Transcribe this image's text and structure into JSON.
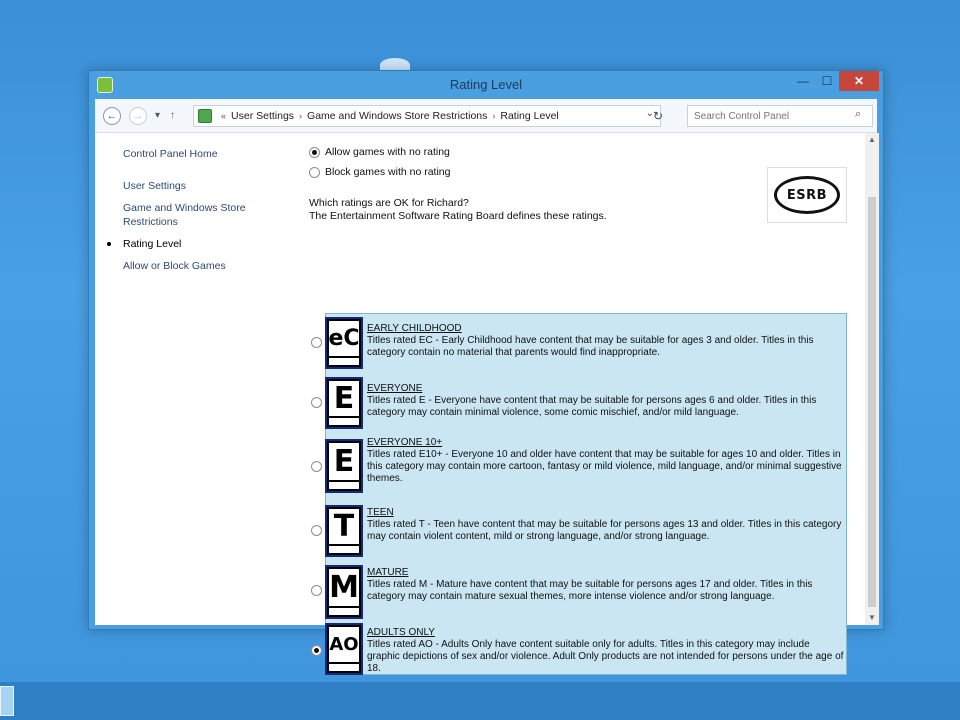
{
  "window": {
    "title": "Rating Level",
    "controls": {
      "minimize": "—",
      "maximize": "☐",
      "close": "✕"
    }
  },
  "nav": {
    "back": "←",
    "forward": "→",
    "recent": "▾",
    "up": "↑",
    "breadcrumb": [
      "User Settings",
      "Game and Windows Store Restrictions",
      "Rating Level"
    ],
    "crumb_prefix": "«",
    "separator": "›",
    "dropdown": "⌄",
    "refresh": "↻",
    "search_placeholder": "Search Control Panel",
    "search_glyph": "⌕"
  },
  "sidebar": {
    "items": [
      {
        "label": "Control Panel Home"
      },
      {
        "label": "User Settings"
      },
      {
        "label": "Game and Windows Store Restrictions"
      },
      {
        "label": "Rating Level"
      },
      {
        "label": "Allow or Block Games"
      }
    ]
  },
  "main": {
    "allow_no_rating": "Allow games with no rating",
    "block_no_rating": "Block games with no rating",
    "question": "Which ratings are OK for Richard?",
    "esrb_note": "The Entertainment Software Rating Board defines these ratings.",
    "esrb_logo": "ESRB",
    "ratings": [
      {
        "letter": "eC",
        "title": "EARLY CHILDHOOD",
        "desc": "Titles rated EC - Early Childhood have content that may be suitable for ages 3 and older. Titles in this category contain no material that parents would find inappropriate.",
        "checked": false
      },
      {
        "letter": "E",
        "title": "EVERYONE",
        "desc": "Titles rated E - Everyone have content that may be suitable for persons ages 6 and older. Titles in this category may contain minimal violence, some comic mischief, and/or mild language.",
        "checked": false
      },
      {
        "letter": "E",
        "title": "EVERYONE 10+",
        "desc": "Titles rated E10+ - Everyone 10 and older have content that may be suitable for ages 10 and older. Titles in this category may contain more cartoon, fantasy or mild violence, mild language, and/or minimal suggestive themes.",
        "checked": false
      },
      {
        "letter": "T",
        "title": "TEEN",
        "desc": "Titles rated T - Teen have content that may be suitable for persons ages 13 and older. Titles in this category may contain violent content, mild or strong language, and/or strong language.",
        "checked": false
      },
      {
        "letter": "M",
        "title": "MATURE",
        "desc": "Titles rated M - Mature have content that may be suitable for persons ages 17 and older. Titles in this category may contain mature sexual themes, more intense violence and/or strong language.",
        "checked": false
      },
      {
        "letter": "AO",
        "title": "ADULTS ONLY",
        "desc": "Titles rated AO - Adults Only have content suitable only for adults. Titles in this category may include graphic depictions of sex and/or violence. Adult Only products are not intended for persons under the age of 18.",
        "checked": true
      }
    ]
  },
  "colors": {
    "panel": "#c9e6f2",
    "badge": "#13297a",
    "close": "#c7463c"
  }
}
